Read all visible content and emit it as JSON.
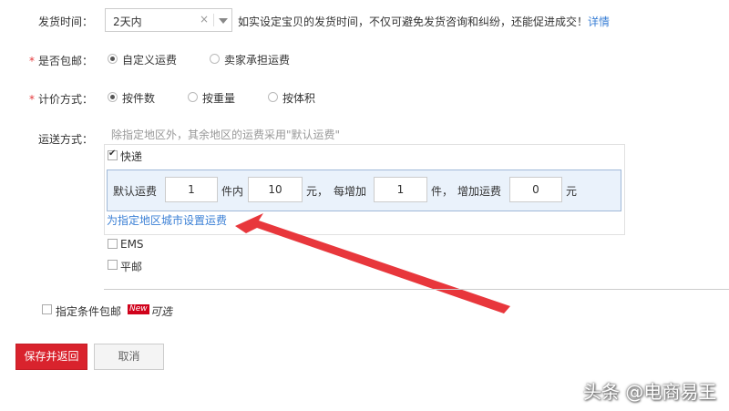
{
  "delivery": {
    "label": "发货时间：",
    "selected": "2天内",
    "clear_glyph": "×",
    "hint": "如实设定宝贝的发货时间，不仅可避免发货咨询和纠纷，还能促进成交！",
    "detail_link": "详情"
  },
  "free_shipping": {
    "required_mark": "*",
    "label": "是否包邮：",
    "options": [
      "自定义运费",
      "卖家承担运费"
    ],
    "selected_index": 0
  },
  "pricing": {
    "required_mark": "*",
    "label": "计价方式：",
    "options": [
      "按件数",
      "按重量",
      "按体积"
    ],
    "selected_index": 0
  },
  "shipping_method": {
    "label": "运送方式：",
    "hint": "除指定地区外，其余地区的运费采用\"默认运费\"",
    "express": {
      "label": "快递",
      "checked": true,
      "default_fee_label": "默认运费",
      "first_qty": "1",
      "first_qty_unit": "件内",
      "first_fee": "10",
      "first_fee_unit": "元，",
      "add_label": "每增加",
      "add_qty": "1",
      "add_qty_unit": "件，",
      "add_fee_label": "增加运费",
      "add_fee": "0",
      "add_fee_unit": "元",
      "region_link": "为指定地区城市设置运费"
    },
    "ems": {
      "label": "EMS",
      "checked": false
    },
    "surface_mail": {
      "label": "平邮",
      "checked": false
    }
  },
  "conditional_free": {
    "label": "指定条件包邮",
    "badge": "New",
    "optional_tag": "可选",
    "checked": false
  },
  "actions": {
    "save_label": "保存并返回",
    "cancel_label": "取消"
  },
  "colors": {
    "primary_button": "#d9232d",
    "arrow": "#e8373c",
    "link": "#3a7fd5",
    "fee_panel_bg": "#eaf2fb"
  },
  "watermark": "头条 @电商易王"
}
